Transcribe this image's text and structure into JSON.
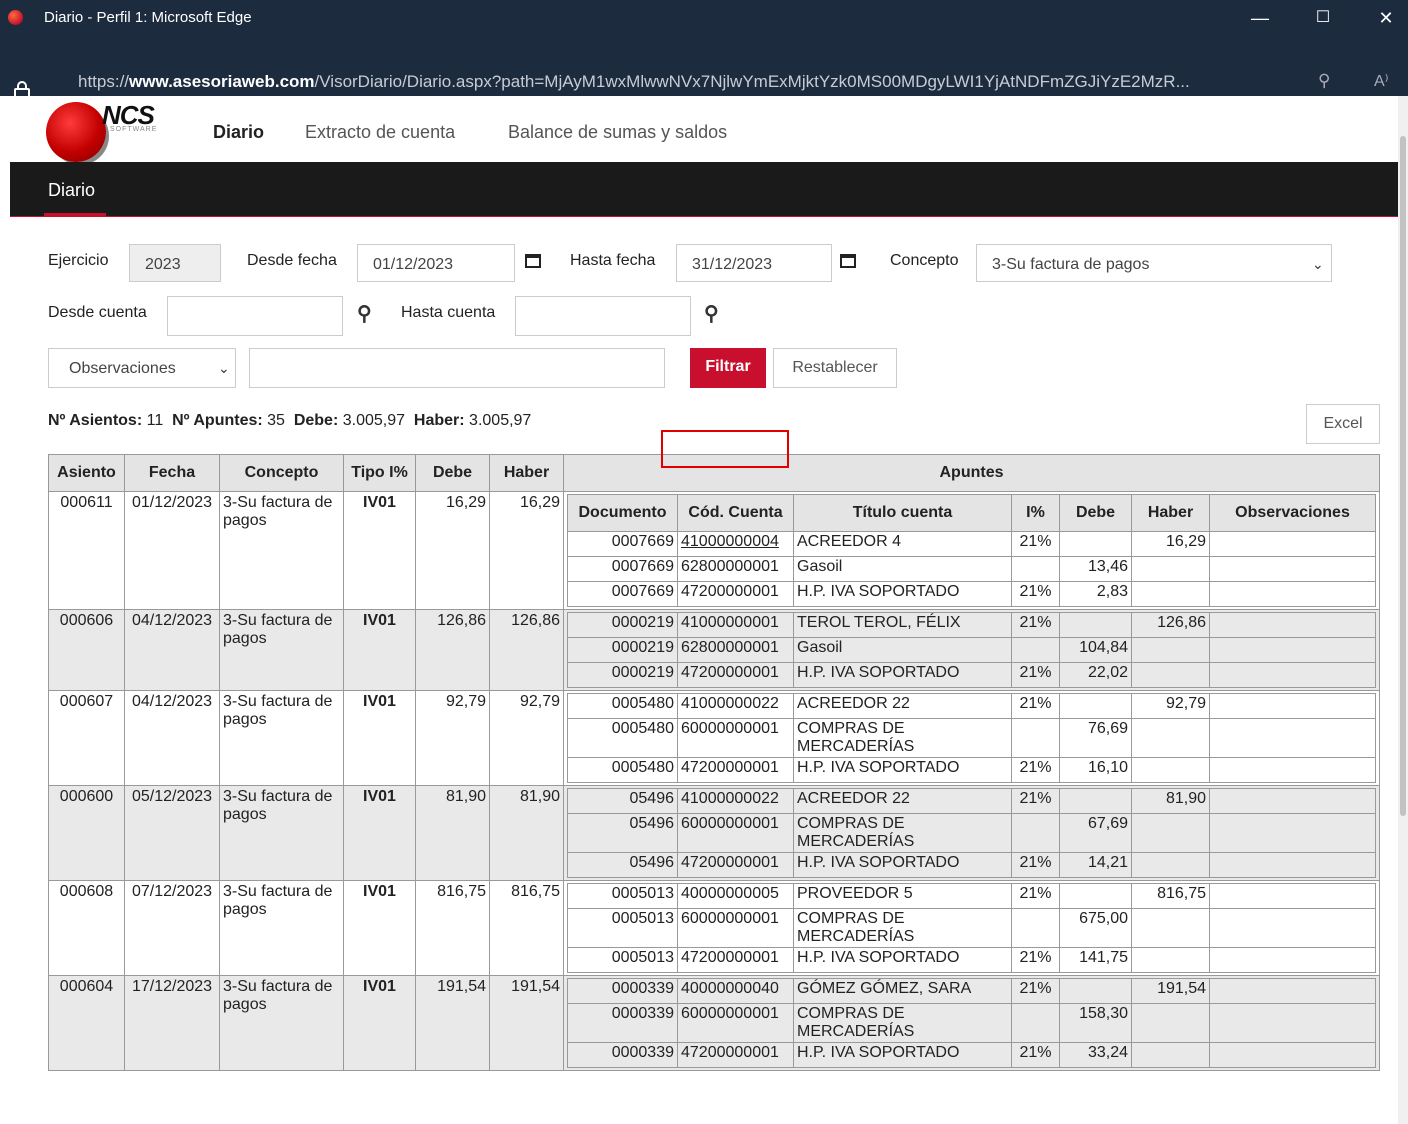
{
  "browser": {
    "window_title": "Diario - Perfil 1: Microsoft Edge",
    "url_prefix": "https://",
    "url_host": "www.asesoriaweb.com",
    "url_path": "/VisorDiario/Diario.aspx?path=MjAyM1wxMlwwNVx7NjlwYmExMjktYzk0MS00MDgyLWI1YjAtNDFmZGJiYzE2MzR..."
  },
  "nav": {
    "logo": "NCS",
    "logo_sub": "SOFTWARE",
    "links": [
      "Diario",
      "Extracto de cuenta",
      "Balance de sumas y saldos"
    ]
  },
  "section_title": "Diario",
  "filters": {
    "ejercicio_label": "Ejercicio",
    "ejercicio_value": "2023",
    "desde_fecha_label": "Desde fecha",
    "desde_fecha_value": "01/12/2023",
    "hasta_fecha_label": "Hasta fecha",
    "hasta_fecha_value": "31/12/2023",
    "concepto_label": "Concepto",
    "concepto_value": "3-Su factura de pagos",
    "desde_cuenta_label": "Desde cuenta",
    "hasta_cuenta_label": "Hasta cuenta",
    "observaciones_select": "Observaciones",
    "filtrar": "Filtrar",
    "restablecer": "Restablecer"
  },
  "summary": {
    "asientos_label": "Nº Asientos:",
    "asientos": "11",
    "apuntes_label": "Nº Apuntes:",
    "apuntes": "35",
    "debe_label": "Debe:",
    "debe": "3.005,97",
    "haber_label": "Haber:",
    "haber": "3.005,97",
    "excel": "Excel"
  },
  "table": {
    "headers": [
      "Asiento",
      "Fecha",
      "Concepto",
      "Tipo I%",
      "Debe",
      "Haber",
      "Apuntes"
    ],
    "sub_headers": [
      "Documento",
      "Cód. Cuenta",
      "Título cuenta",
      "I%",
      "Debe",
      "Haber",
      "Observaciones"
    ],
    "rows": [
      {
        "asiento": "000611",
        "fecha": "01/12/2023",
        "concepto": "3-Su factura de pagos",
        "tipo": "IV01",
        "debe": "16,29",
        "haber": "16,29",
        "apuntes": [
          {
            "doc": "0007669",
            "cuenta": "41000000004",
            "titulo": "ACREEDOR 4",
            "iva": "21%",
            "debe": "",
            "haber": "16,29"
          },
          {
            "doc": "0007669",
            "cuenta": "62800000001",
            "titulo": "Gasoil",
            "iva": "",
            "debe": "13,46",
            "haber": ""
          },
          {
            "doc": "0007669",
            "cuenta": "47200000001",
            "titulo": "H.P. IVA SOPORTADO",
            "iva": "21%",
            "debe": "2,83",
            "haber": ""
          }
        ]
      },
      {
        "asiento": "000606",
        "fecha": "04/12/2023",
        "concepto": "3-Su factura de pagos",
        "tipo": "IV01",
        "debe": "126,86",
        "haber": "126,86",
        "apuntes": [
          {
            "doc": "0000219",
            "cuenta": "41000000001",
            "titulo": "TEROL TEROL, FÉLIX",
            "iva": "21%",
            "debe": "",
            "haber": "126,86"
          },
          {
            "doc": "0000219",
            "cuenta": "62800000001",
            "titulo": "Gasoil",
            "iva": "",
            "debe": "104,84",
            "haber": ""
          },
          {
            "doc": "0000219",
            "cuenta": "47200000001",
            "titulo": "H.P. IVA SOPORTADO",
            "iva": "21%",
            "debe": "22,02",
            "haber": ""
          }
        ]
      },
      {
        "asiento": "000607",
        "fecha": "04/12/2023",
        "concepto": "3-Su factura de pagos",
        "tipo": "IV01",
        "debe": "92,79",
        "haber": "92,79",
        "apuntes": [
          {
            "doc": "0005480",
            "cuenta": "41000000022",
            "titulo": "ACREEDOR 22",
            "iva": "21%",
            "debe": "",
            "haber": "92,79"
          },
          {
            "doc": "0005480",
            "cuenta": "60000000001",
            "titulo": "COMPRAS DE MERCADERÍAS",
            "iva": "",
            "debe": "76,69",
            "haber": ""
          },
          {
            "doc": "0005480",
            "cuenta": "47200000001",
            "titulo": "H.P. IVA SOPORTADO",
            "iva": "21%",
            "debe": "16,10",
            "haber": ""
          }
        ]
      },
      {
        "asiento": "000600",
        "fecha": "05/12/2023",
        "concepto": "3-Su factura de pagos",
        "tipo": "IV01",
        "debe": "81,90",
        "haber": "81,90",
        "apuntes": [
          {
            "doc": "05496",
            "cuenta": "41000000022",
            "titulo": "ACREEDOR 22",
            "iva": "21%",
            "debe": "",
            "haber": "81,90"
          },
          {
            "doc": "05496",
            "cuenta": "60000000001",
            "titulo": "COMPRAS DE MERCADERÍAS",
            "iva": "",
            "debe": "67,69",
            "haber": ""
          },
          {
            "doc": "05496",
            "cuenta": "47200000001",
            "titulo": "H.P. IVA SOPORTADO",
            "iva": "21%",
            "debe": "14,21",
            "haber": ""
          }
        ]
      },
      {
        "asiento": "000608",
        "fecha": "07/12/2023",
        "concepto": "3-Su factura de pagos",
        "tipo": "IV01",
        "debe": "816,75",
        "haber": "816,75",
        "apuntes": [
          {
            "doc": "0005013",
            "cuenta": "40000000005",
            "titulo": "PROVEEDOR 5",
            "iva": "21%",
            "debe": "",
            "haber": "816,75"
          },
          {
            "doc": "0005013",
            "cuenta": "60000000001",
            "titulo": "COMPRAS DE MERCADERÍAS",
            "iva": "",
            "debe": "675,00",
            "haber": ""
          },
          {
            "doc": "0005013",
            "cuenta": "47200000001",
            "titulo": "H.P. IVA SOPORTADO",
            "iva": "21%",
            "debe": "141,75",
            "haber": ""
          }
        ]
      },
      {
        "asiento": "000604",
        "fecha": "17/12/2023",
        "concepto": "3-Su factura de pagos",
        "tipo": "IV01",
        "debe": "191,54",
        "haber": "191,54",
        "apuntes": [
          {
            "doc": "0000339",
            "cuenta": "40000000040",
            "titulo": "GÓMEZ GÓMEZ, SARA",
            "iva": "21%",
            "debe": "",
            "haber": "191,54"
          },
          {
            "doc": "0000339",
            "cuenta": "60000000001",
            "titulo": "COMPRAS DE MERCADERÍAS",
            "iva": "",
            "debe": "158,30",
            "haber": ""
          },
          {
            "doc": "0000339",
            "cuenta": "47200000001",
            "titulo": "H.P. IVA SOPORTADO",
            "iva": "21%",
            "debe": "33,24",
            "haber": ""
          }
        ]
      }
    ]
  },
  "colors": {
    "accent": "#c8102e",
    "titlebar": "#1d2b3f",
    "header_bg": "#1a1a1a",
    "alt_row": "#e9e9e9"
  }
}
